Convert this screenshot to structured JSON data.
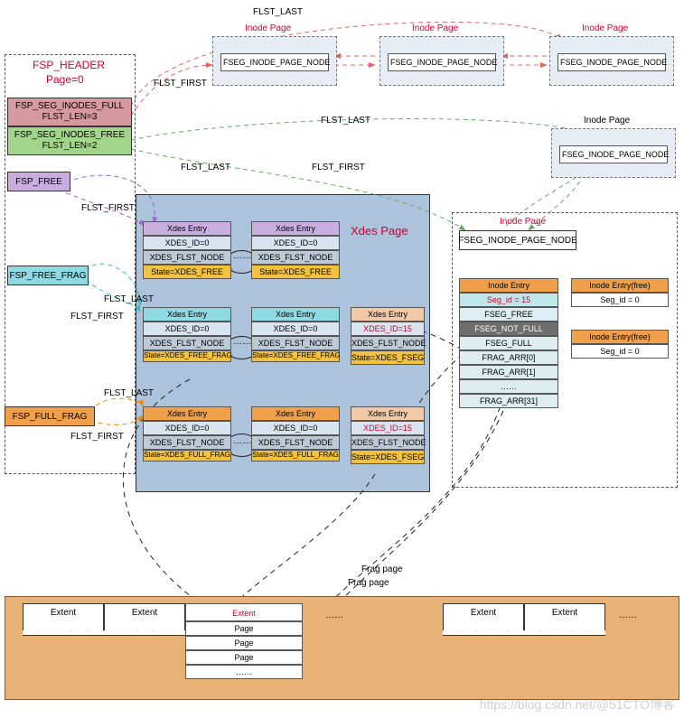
{
  "labels": {
    "flst_last": "FLST_LAST",
    "flst_first": "FLST_FIRST",
    "frag_page": "Frag page"
  },
  "fsp_header": {
    "title": "FSP_HEADER",
    "subtitle": "Page=0",
    "full": {
      "l1": "FSP_SEG_INODES_FULL",
      "l2": "FLST_LEN=3"
    },
    "free": {
      "l1": "FSP_SEG_INODES_FREE",
      "l2": "FLST_LEN=2"
    },
    "fsp_free": "FSP_FREE",
    "fsp_free_frag": "FSP_FREE_FRAG",
    "fsp_full_frag": "FSP_FULL_FRAG"
  },
  "inode_pages": {
    "title": "Inode Page",
    "inner": "FSEG_INODE_PAGE_NODE"
  },
  "xdes_page": {
    "title": "Xdes Page",
    "entry_title": "Xdes Entry",
    "xdes_id0": "XDES_ID=0",
    "xdes_id15": "XDES_ID=15",
    "flst_node": "XDES_FLST_NODE",
    "state_free": "State=XDES_FREE",
    "state_free_frag": "State=XDES_FREE_FRAG",
    "state_full_frag": "State=XDES_FULL_FRAG",
    "state_fseg": "State=XDES_FSEG"
  },
  "inode_entry_panel": {
    "title": "Inode Page",
    "inner": "FSEG_INODE_PAGE_NODE",
    "entry": {
      "title": "Inode Entry",
      "seg": "Seg_id = 15",
      "fseg_free": "FSEG_FREE",
      "fseg_not_full": "FSEG_NOT_FULL",
      "fseg_full": "FSEG_FULL",
      "frag0": "FRAG_ARR[0]",
      "frag1": "FRAG_ARR[1]",
      "dots": "……",
      "frag31": "FRAG_ARR[31]"
    },
    "free_entry": {
      "title": "Inode Entry(free)",
      "seg": "Seg_id = 0"
    }
  },
  "extent_area": {
    "extent": "Extent",
    "extent_red": "Extent",
    "page": "Page",
    "dots": "……"
  },
  "watermark": "https://blog.csdn.net/@51CTO博客"
}
